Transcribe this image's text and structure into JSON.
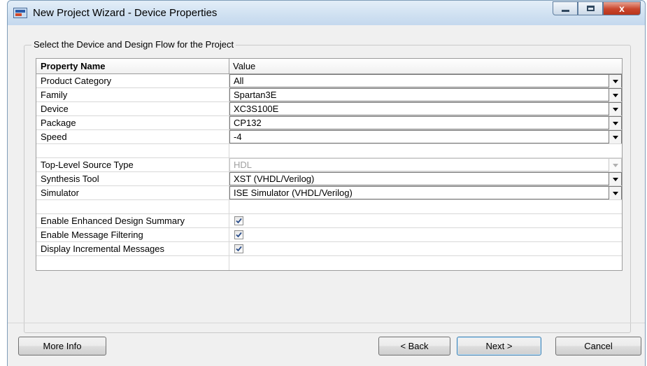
{
  "window": {
    "title": "New Project Wizard - Device Properties",
    "close_glyph": "x"
  },
  "group": {
    "label": "Select the Device and Design Flow for the Project"
  },
  "grid": {
    "header": {
      "name": "Property Name",
      "value": "Value"
    },
    "rows": [
      {
        "name": "Product Category",
        "value": "All",
        "kind": "combo"
      },
      {
        "name": "Family",
        "value": "Spartan3E",
        "kind": "combo"
      },
      {
        "name": "Device",
        "value": "XC3S100E",
        "kind": "combo"
      },
      {
        "name": "Package",
        "value": "CP132",
        "kind": "combo"
      },
      {
        "name": "Speed",
        "value": "-4",
        "kind": "combo"
      },
      {
        "name": "Top-Level Source Type",
        "value": "HDL",
        "kind": "combo-disabled"
      },
      {
        "name": "Synthesis Tool",
        "value": "XST (VHDL/Verilog)",
        "kind": "combo"
      },
      {
        "name": "Simulator",
        "value": "ISE Simulator (VHDL/Verilog)",
        "kind": "combo"
      },
      {
        "name": "Enable Enhanced Design Summary",
        "checked": true,
        "kind": "checkbox"
      },
      {
        "name": "Enable Message Filtering",
        "checked": true,
        "kind": "checkbox"
      },
      {
        "name": "Display Incremental Messages",
        "checked": true,
        "kind": "checkbox"
      }
    ]
  },
  "buttons": {
    "more_info": "More Info",
    "back": "< Back",
    "next": "Next >",
    "cancel": "Cancel"
  },
  "colors": {
    "close_button": "#c9462c",
    "default_button_border": "#3c7fb1",
    "checkmark": "#2a4d8a"
  }
}
